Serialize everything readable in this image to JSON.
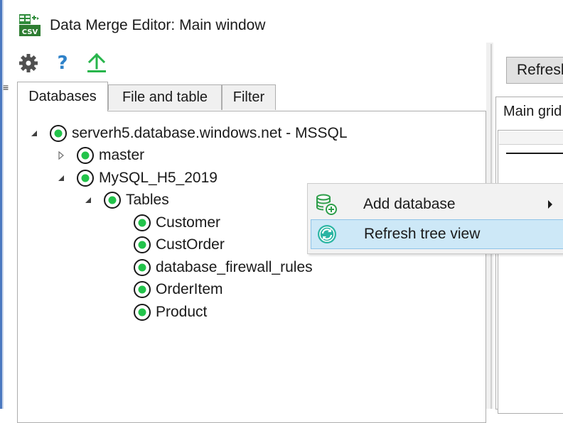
{
  "window": {
    "title": "Data Merge Editor: Main window",
    "app_icon_text": "CSV"
  },
  "toolbar": {
    "settings_icon": "gear-icon",
    "help_label": "?",
    "upload_icon": "upload-arrow-icon"
  },
  "tabs": [
    {
      "label": "Databases",
      "active": true
    },
    {
      "label": "File and table",
      "active": false
    },
    {
      "label": "Filter",
      "active": false
    }
  ],
  "tree": {
    "server": "serverh5.database.windows.net - MSSQL",
    "db_master": "master",
    "db_mysql": "MySQL_H5_2019",
    "tables_folder": "Tables",
    "tables": [
      "Customer",
      "CustOrder",
      "database_firewall_rules",
      "OrderItem",
      "Product"
    ]
  },
  "right_pane": {
    "refresh_button": "Refresh",
    "main_tab": "Main grid"
  },
  "context_menu": {
    "items": [
      {
        "label": "Add database",
        "icon": "database-add-icon",
        "has_submenu": true,
        "highlighted": false
      },
      {
        "label": "Refresh tree view",
        "icon": "refresh-icon",
        "has_submenu": false,
        "highlighted": true
      }
    ]
  },
  "colors": {
    "node_green": "#22c34a",
    "accent_blue": "#2f82c9",
    "upload_green": "#27b54b",
    "menu_highlight": "#cde8f7",
    "refresh_teal": "#2bb5a3"
  }
}
